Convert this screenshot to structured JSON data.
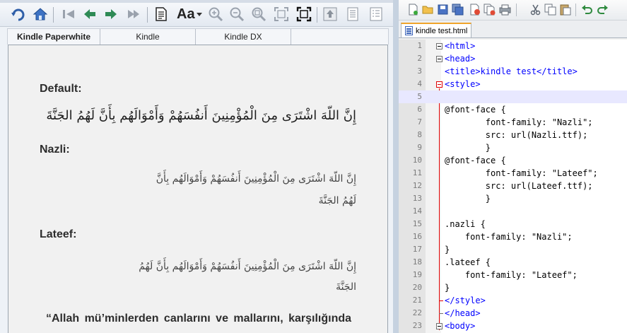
{
  "previewer": {
    "toolbar": {
      "font_size_label": "Aa",
      "icons": [
        "rotate-icon",
        "home-icon",
        "first-page-icon",
        "previous-page-icon",
        "next-page-icon",
        "last-page-icon",
        "document-icon",
        "font-size-icon",
        "zoom-in-icon",
        "zoom-out-icon",
        "zoom-reset-icon",
        "fit-page-icon",
        "fullscreen-icon",
        "upload-icon",
        "page-view-icon",
        "list-view-icon"
      ]
    },
    "device_tabs": [
      "Kindle Paperwhite",
      "Kindle",
      "Kindle DX"
    ],
    "active_tab": "Kindle Paperwhite",
    "content": {
      "default_heading": "Default:",
      "default_text": "إِنَّ اللّهَ اشْتَرَى مِنَ الْمُؤْمِنِينَ أَنفُسَهُمْ وَأَمْوَالَهُم بِأَنَّ لَهُمُ الجَنَّةَ",
      "nazli_heading": "Nazli:",
      "nazli_line1": "إِنَّ اللّهَ اشْتَرَى مِنَ الْمُؤْمِنِينَ أَنفُسَهُمْ وَأَمْوَالَهُم بِأَنَّ",
      "nazli_line2": "لَهُمُ الجَنَّةَ",
      "lateef_heading": "Lateef:",
      "lateef_line1": "إِنَّ اللّهَ اشْتَرَى مِنَ الْمُؤْمِنِينَ أَنفُسَهُمْ وَأَمْوَالَهُم بِأَنَّ لَهُمُ",
      "lateef_line2": "الجَنَّةَ",
      "quote": "“Allah mü’minlerden canlarını ve mallarını, karşılığında"
    }
  },
  "editor": {
    "toolbar_icons": [
      "new-file-icon",
      "open-file-icon",
      "save-icon",
      "save-all-icon",
      "close-icon",
      "close-all-icon",
      "print-icon",
      "cut-icon",
      "copy-icon",
      "paste-icon",
      "undo-icon",
      "redo-icon"
    ],
    "tab_label": "kindle test.html",
    "lines": [
      {
        "n": "1",
        "t": "<html>"
      },
      {
        "n": "2",
        "t": "<head>"
      },
      {
        "n": "3",
        "t": "<title>kindle test</title>"
      },
      {
        "n": "4",
        "t": "<style>"
      },
      {
        "n": "5",
        "t": ""
      },
      {
        "n": "6",
        "t": "@font-face {"
      },
      {
        "n": "7",
        "t": "        font-family: \"Nazli\";"
      },
      {
        "n": "8",
        "t": "        src: url(Nazli.ttf);"
      },
      {
        "n": "9",
        "t": "        }"
      },
      {
        "n": "10",
        "t": "@font-face {"
      },
      {
        "n": "11",
        "t": "        font-family: \"Lateef\";"
      },
      {
        "n": "12",
        "t": "        src: url(Lateef.ttf);"
      },
      {
        "n": "13",
        "t": "        }"
      },
      {
        "n": "14",
        "t": ""
      },
      {
        "n": "15",
        "t": ".nazli {"
      },
      {
        "n": "16",
        "t": "    font-family: \"Nazli\";"
      },
      {
        "n": "17",
        "t": "}"
      },
      {
        "n": "18",
        "t": ".lateef {"
      },
      {
        "n": "19",
        "t": "    font-family: \"Lateef\";"
      },
      {
        "n": "20",
        "t": "}"
      },
      {
        "n": "21",
        "t": "</style>"
      },
      {
        "n": "22",
        "t": "</head>"
      },
      {
        "n": "23",
        "t": "<body>"
      }
    ]
  }
}
